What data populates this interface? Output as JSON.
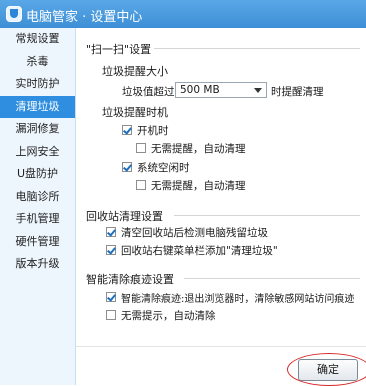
{
  "window": {
    "title": "电脑管家 · 设置中心"
  },
  "sidebar": {
    "items": [
      {
        "label": "常规设置"
      },
      {
        "label": "杀毒"
      },
      {
        "label": "实时防护"
      },
      {
        "label": "清理垃圾"
      },
      {
        "label": "漏洞修复"
      },
      {
        "label": "上网安全"
      },
      {
        "label": "U盘防护"
      },
      {
        "label": "电脑诊所"
      },
      {
        "label": "手机管理"
      },
      {
        "label": "硬件管理"
      },
      {
        "label": "版本升级"
      }
    ],
    "active_index": 3
  },
  "scan_settings": {
    "group_title": "\"扫一扫\"设置",
    "size_reminder_title": "垃圾提醒大小",
    "size_prefix": "垃圾值超过",
    "size_value": "500 MB",
    "size_suffix": "时提醒清理",
    "time_reminder_title": "垃圾提醒时机",
    "options": [
      {
        "label": "开机时",
        "checked": true
      },
      {
        "label": "无需提醒，自动清理",
        "checked": false
      },
      {
        "label": "系统空闲时",
        "checked": true
      },
      {
        "label": "无需提醒，自动清理",
        "checked": false
      }
    ]
  },
  "recycle_settings": {
    "group_title": "回收站清理设置",
    "options": [
      {
        "label": "清空回收站后检测电脑残留垃圾",
        "checked": true
      },
      {
        "label": "回收站右键菜单栏添加\"清理垃圾\"",
        "checked": true
      }
    ]
  },
  "trace_settings": {
    "group_title": "智能清除痕迹设置",
    "options": [
      {
        "label": "智能清除痕迹:退出浏览器时，清除敏感网站访问痕迹",
        "checked": true
      },
      {
        "label": "无需提示，自动清除",
        "checked": false
      }
    ]
  },
  "footer": {
    "ok_label": "确定"
  },
  "colors": {
    "accent": "#2f8ee0",
    "annotation": "#d72a2a"
  }
}
